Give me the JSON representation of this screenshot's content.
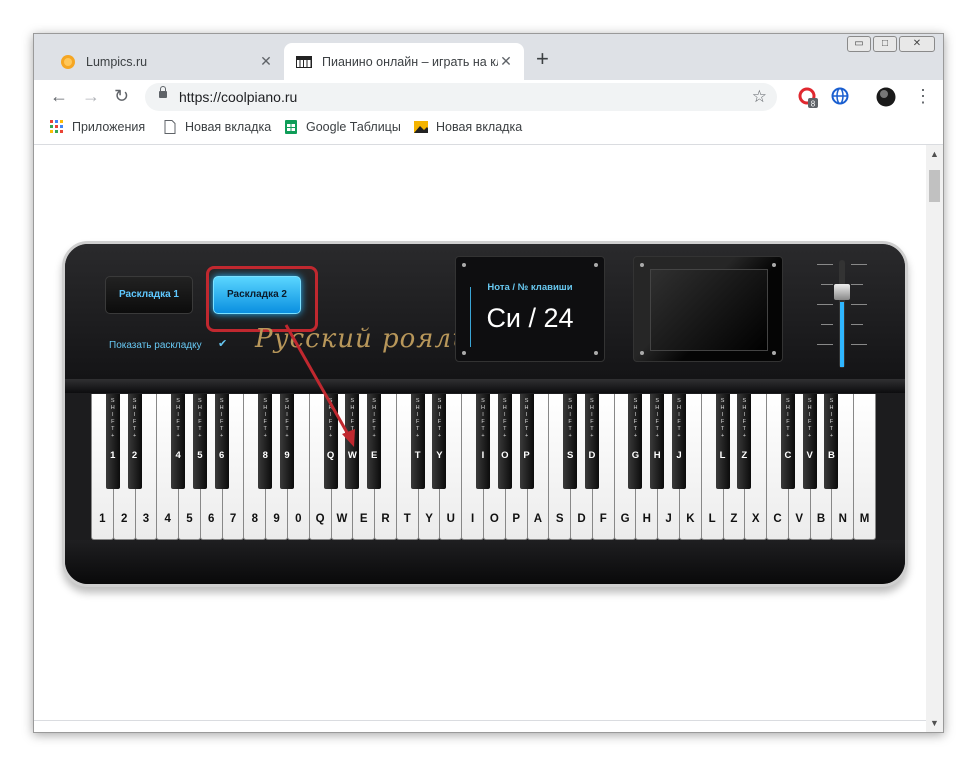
{
  "browser": {
    "tabs": [
      {
        "title": "Lumpics.ru",
        "icon": "orange-icon"
      },
      {
        "title": "Пианино онлайн – играть на кл",
        "icon": "piano-icon"
      }
    ],
    "url": "https://coolpiano.ru",
    "extension_badge": "8",
    "window_controls": [
      "▭",
      "□",
      "✕"
    ]
  },
  "bookmarks": [
    {
      "label": "Приложения",
      "icon": "apps-grid-icon"
    },
    {
      "label": "Новая вкладка",
      "icon": "page-icon"
    },
    {
      "label": "Google Таблицы",
      "icon": "sheets-icon"
    },
    {
      "label": "Новая вкладка",
      "icon": "image-icon"
    }
  ],
  "piano": {
    "layout_button_1": "Раскладка 1",
    "layout_button_2": "Раскладка 2",
    "show_layout_label": "Показать раскладку",
    "show_layout_checked": true,
    "brand": "Русский рояль",
    "display_label": "Нота / № клавиши",
    "display_value": "Си / 24",
    "white_keys": [
      "1",
      "2",
      "3",
      "4",
      "5",
      "6",
      "7",
      "8",
      "9",
      "0",
      "Q",
      "W",
      "E",
      "R",
      "T",
      "Y",
      "U",
      "I",
      "O",
      "P",
      "A",
      "S",
      "D",
      "F",
      "G",
      "H",
      "J",
      "K",
      "L",
      "Z",
      "X",
      "C",
      "V",
      "B",
      "N",
      "M"
    ],
    "black_keys": [
      "1",
      "2",
      "4",
      "5",
      "6",
      "8",
      "9",
      "Q",
      "W",
      "E",
      "T",
      "Y",
      "I",
      "O",
      "P",
      "S",
      "D",
      "G",
      "H",
      "J",
      "L",
      "Z",
      "C",
      "V",
      "B"
    ],
    "shift_text": "SHIFT+",
    "accent_color": "#2fb6ff",
    "highlight_color": "#c0282f"
  }
}
